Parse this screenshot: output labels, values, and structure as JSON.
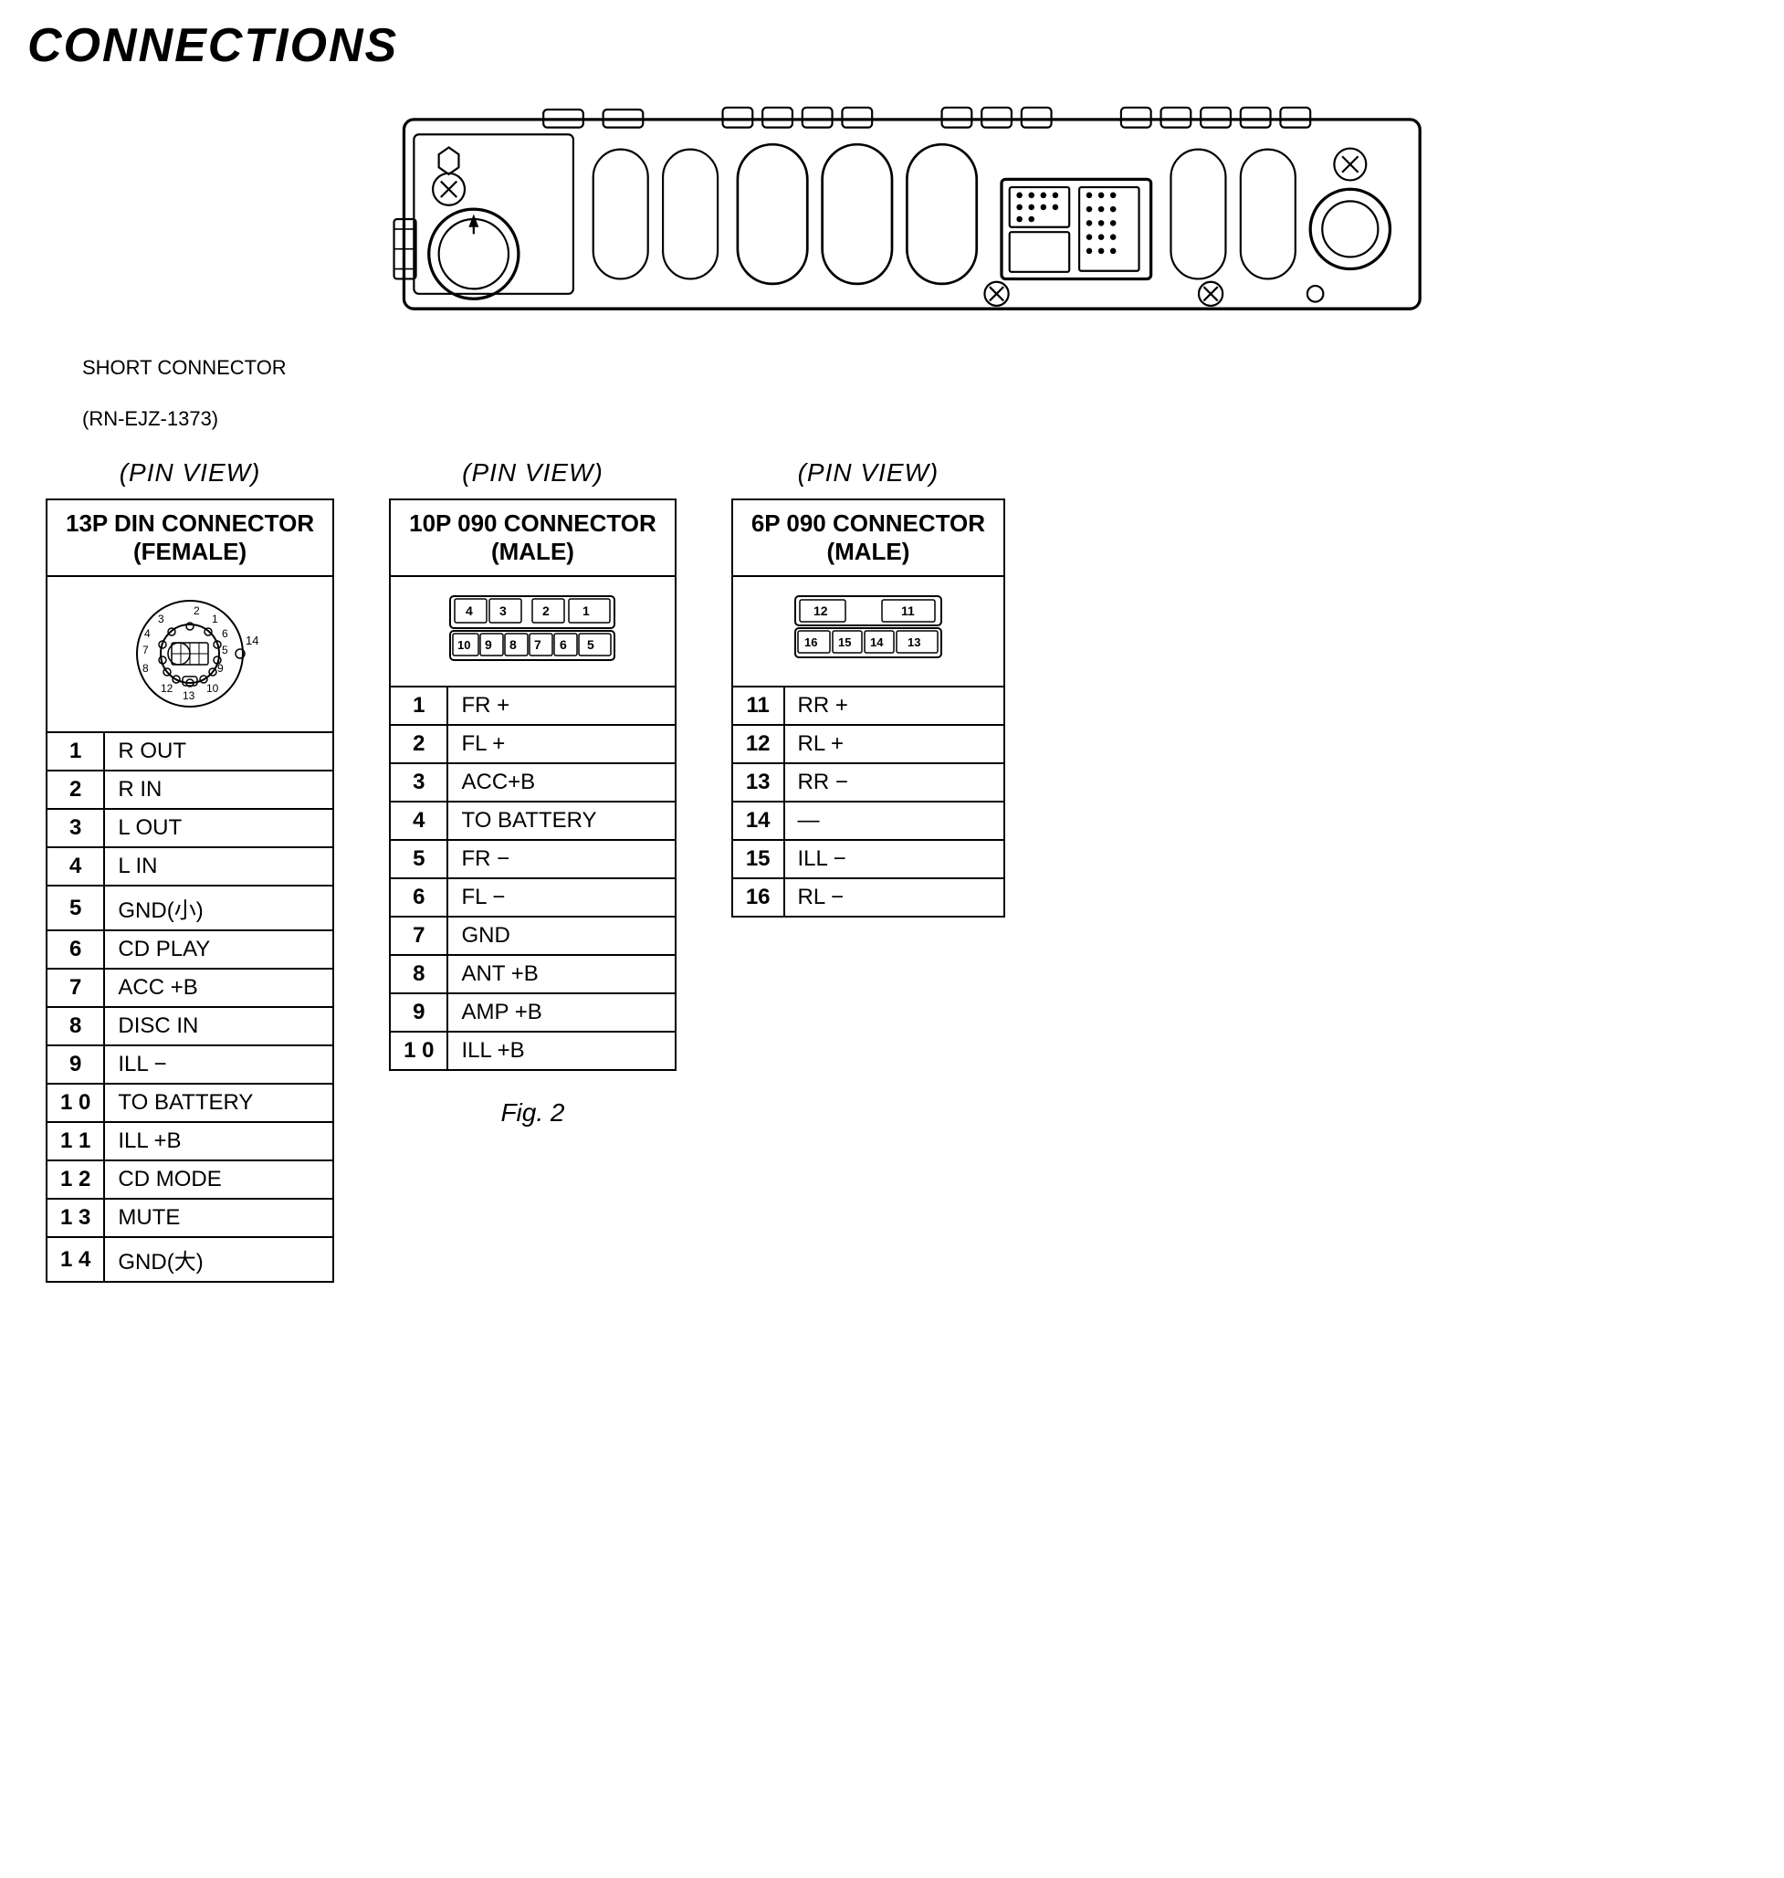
{
  "page": {
    "title": "CONNECTIONS",
    "fig_label": "Fig. 2",
    "short_connector_label": "SHORT CONNECTOR",
    "short_connector_part": "(RN-EJZ-1373)"
  },
  "connector1": {
    "pin_view": "(PIN  VIEW)",
    "title": "13P DIN CONNECTOR",
    "subtitle": "(FEMALE)",
    "pins": [
      {
        "num": "1",
        "name": "R OUT"
      },
      {
        "num": "2",
        "name": "R IN"
      },
      {
        "num": "3",
        "name": "L OUT"
      },
      {
        "num": "4",
        "name": "L IN"
      },
      {
        "num": "5",
        "name": "GND(小)"
      },
      {
        "num": "6",
        "name": "CD PLAY"
      },
      {
        "num": "7",
        "name": "ACC +B"
      },
      {
        "num": "8",
        "name": "DISC IN"
      },
      {
        "num": "9",
        "name": "ILL −"
      },
      {
        "num": "1 0",
        "name": "TO BATTERY"
      },
      {
        "num": "1 1",
        "name": "ILL +B"
      },
      {
        "num": "1 2",
        "name": "CD MODE"
      },
      {
        "num": "1 3",
        "name": "MUTE"
      },
      {
        "num": "1 4",
        "name": "GND(大)"
      }
    ]
  },
  "connector2": {
    "pin_view": "(PIN  VIEW)",
    "title": "10P 090 CONNECTOR",
    "subtitle": "(MALE)",
    "pins": [
      {
        "num": "1",
        "name": "FR +"
      },
      {
        "num": "2",
        "name": "FL +"
      },
      {
        "num": "3",
        "name": "ACC+B"
      },
      {
        "num": "4",
        "name": "TO BATTERY"
      },
      {
        "num": "5",
        "name": "FR −"
      },
      {
        "num": "6",
        "name": "FL −"
      },
      {
        "num": "7",
        "name": "GND"
      },
      {
        "num": "8",
        "name": "ANT +B"
      },
      {
        "num": "9",
        "name": "AMP +B"
      },
      {
        "num": "1 0",
        "name": "ILL +B"
      }
    ]
  },
  "connector3": {
    "pin_view": "(PIN  VIEW)",
    "title": "6P 090 CONNECTOR",
    "subtitle": "(MALE)",
    "pins": [
      {
        "num": "11",
        "name": "RR +"
      },
      {
        "num": "12",
        "name": "RL +"
      },
      {
        "num": "13",
        "name": "RR −"
      },
      {
        "num": "14",
        "name": "—"
      },
      {
        "num": "15",
        "name": "ILL −"
      },
      {
        "num": "16",
        "name": "RL −"
      }
    ]
  }
}
